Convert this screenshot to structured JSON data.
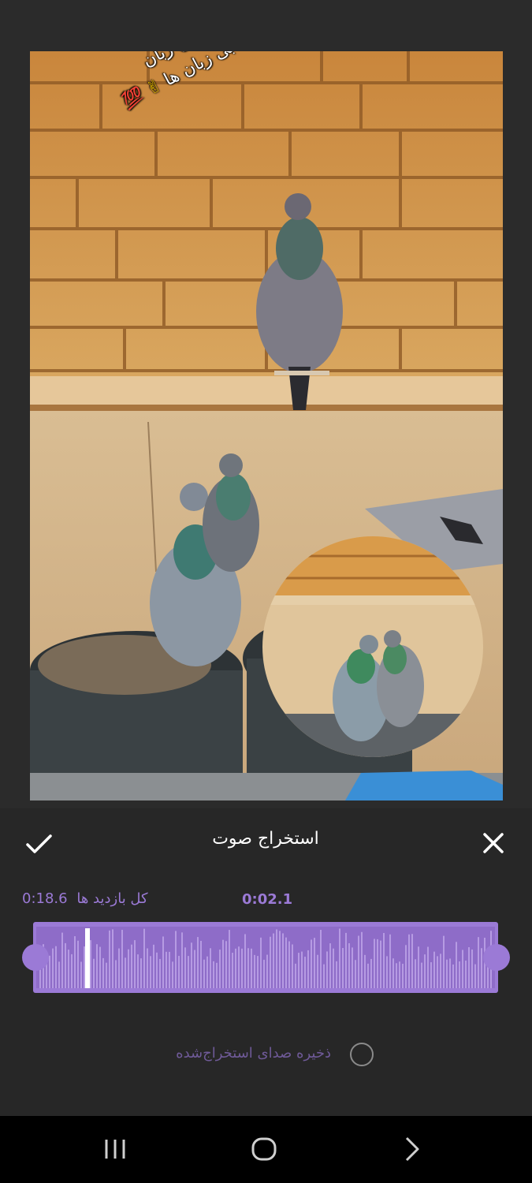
{
  "preview": {
    "overlay_lines": [
      "بعد از خیانت شیرین زبان",
      "دل بستیم به بی زبان ها"
    ],
    "emoji_hand": "✌",
    "emoji_hundred": "💯"
  },
  "panel": {
    "title": "استخراج صوت",
    "total_label": "کل بازدید ها",
    "total_time": "0:18.6",
    "current_time": "0:02.1",
    "save_label": "ذخیره صدای استخراج‌شده",
    "save_checked": false
  },
  "icons": {
    "confirm": "check-icon",
    "close": "close-icon",
    "nav_recents": "recents-icon",
    "nav_home": "home-icon",
    "nav_back": "back-icon"
  },
  "colors": {
    "accent": "#9b7ad6",
    "panel_bg": "#272727",
    "navbar_bg": "#000000"
  }
}
